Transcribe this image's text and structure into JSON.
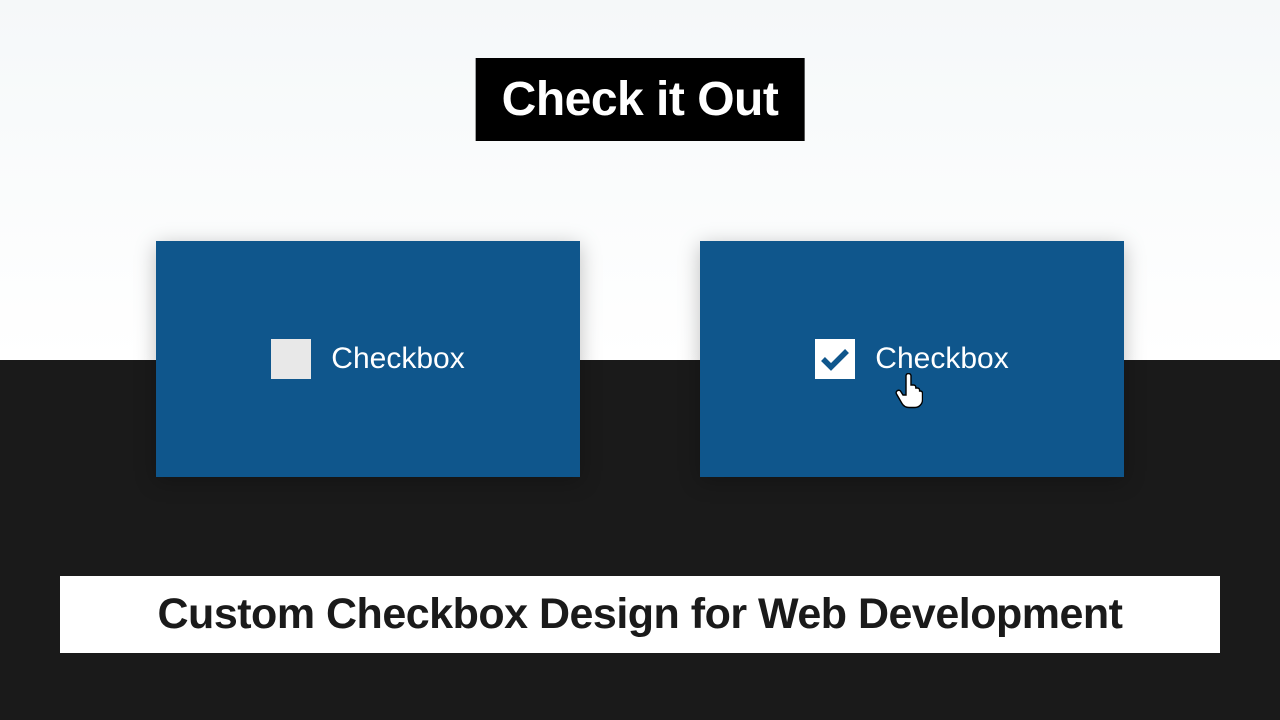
{
  "title": "Check it Out",
  "subtitle": "Custom Checkbox Design for Web Development",
  "cards": {
    "unchecked": {
      "label": "Checkbox"
    },
    "checked": {
      "label": "Checkbox"
    }
  },
  "colors": {
    "card_bg": "#0f568c",
    "dark_bg": "#1a1a1a",
    "title_bg": "#000000"
  }
}
